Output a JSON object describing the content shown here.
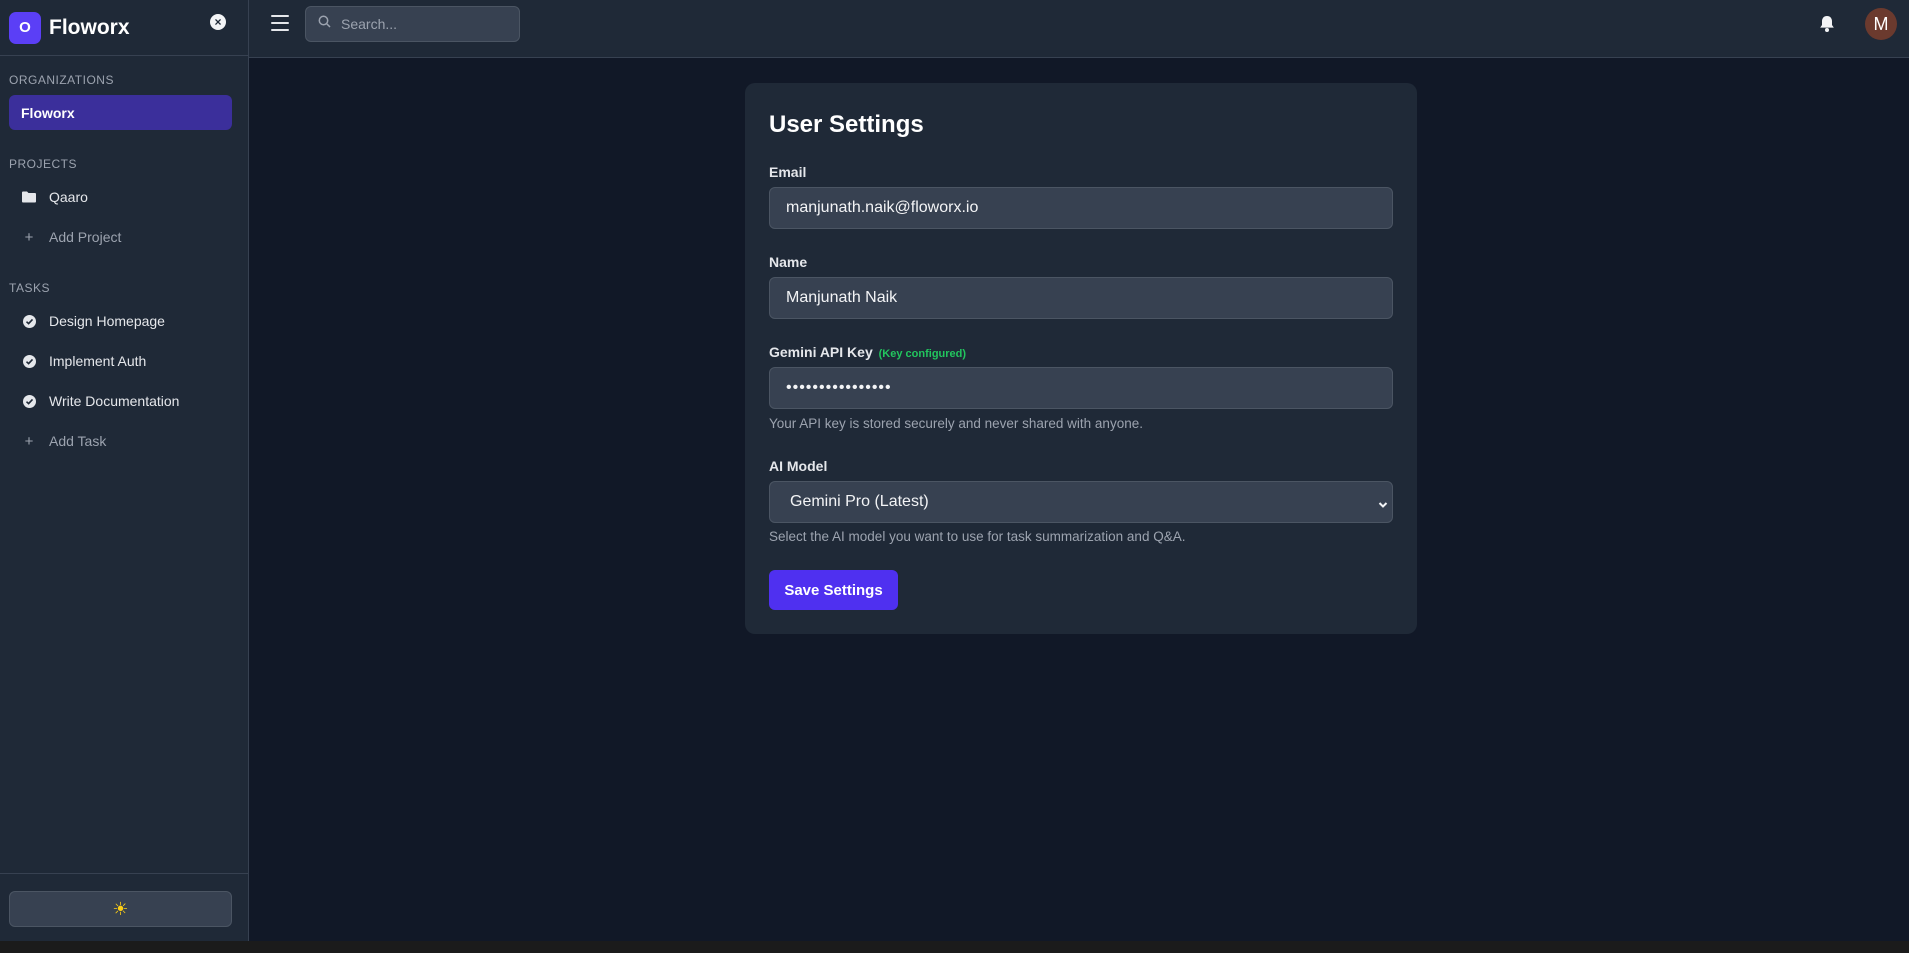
{
  "app": {
    "logo_letter": "O",
    "name": "Floworx"
  },
  "sidebar": {
    "organizations_label": "ORGANIZATIONS",
    "organizations": [
      {
        "label": "Floworx"
      }
    ],
    "projects_label": "PROJECTS",
    "projects": [
      {
        "label": "Qaaro",
        "icon": "folder-icon"
      }
    ],
    "add_project": "Add Project",
    "tasks_label": "TASKS",
    "tasks": [
      {
        "label": "Design Homepage",
        "icon": "check-circle-icon"
      },
      {
        "label": "Implement Auth",
        "icon": "check-circle-icon"
      },
      {
        "label": "Write Documentation",
        "icon": "check-circle-icon"
      }
    ],
    "add_task": "Add Task",
    "theme_icon": "sun-icon"
  },
  "topbar": {
    "search_placeholder": "Search...",
    "avatar_letter": "M"
  },
  "settings": {
    "title": "User Settings",
    "email_label": "Email",
    "email_value": "manjunath.naik@floworx.io",
    "name_label": "Name",
    "name_value": "Manjunath Naik",
    "api_key_label": "Gemini API Key",
    "api_key_status": "(Key configured)",
    "api_key_masked": "••••••••••••••••",
    "api_key_help": "Your API key is stored securely and never shared with anyone.",
    "model_label": "AI Model",
    "model_value": "Gemini Pro (Latest)",
    "model_help": "Select the AI model you want to use for task summarization and Q&A.",
    "save_label": "Save Settings"
  },
  "colors": {
    "accent": "#4f30f0",
    "active_org_bg": "#3b2f9b",
    "success": "#22c55e",
    "background": "#111827",
    "panel": "#1f2937"
  }
}
